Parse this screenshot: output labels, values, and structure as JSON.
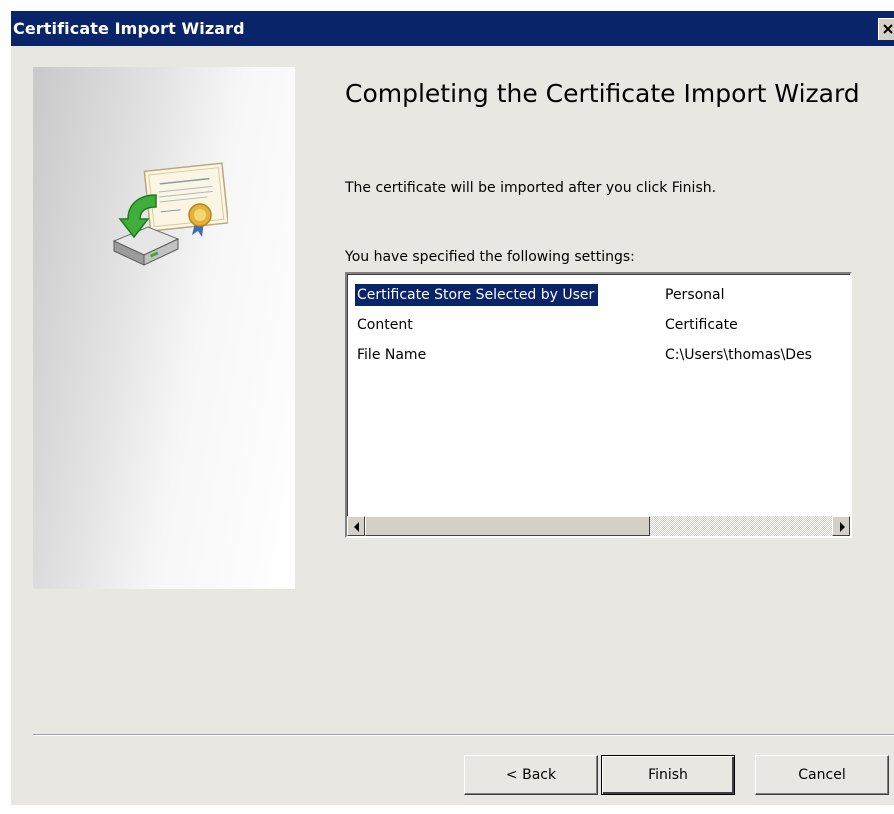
{
  "window": {
    "title": "Certificate Import Wizard",
    "close_icon": "close-icon"
  },
  "side_panel": {
    "art_icon": "certificate-import-icon"
  },
  "main": {
    "heading": "Completing the Certificate Import Wizard",
    "description": "The certificate will be imported after you click Finish.",
    "settings_label": "You have specified the following settings:",
    "settings": [
      {
        "key": "Certificate Store Selected by User",
        "value": "Personal",
        "selected": true
      },
      {
        "key": "Content",
        "value": "Certificate",
        "selected": false
      },
      {
        "key": "File Name",
        "value": "C:\\Users\\thomas\\Des",
        "selected": false
      }
    ],
    "scroll_left_icon": "arrow-left-icon",
    "scroll_right_icon": "arrow-right-icon"
  },
  "buttons": {
    "back_label": "< Back",
    "finish_label": "Finish",
    "cancel_label": "Cancel"
  },
  "colors": {
    "titlebar": "#0a246a",
    "selection": "#0a246a",
    "dialog_bg": "#e9e7e2"
  }
}
